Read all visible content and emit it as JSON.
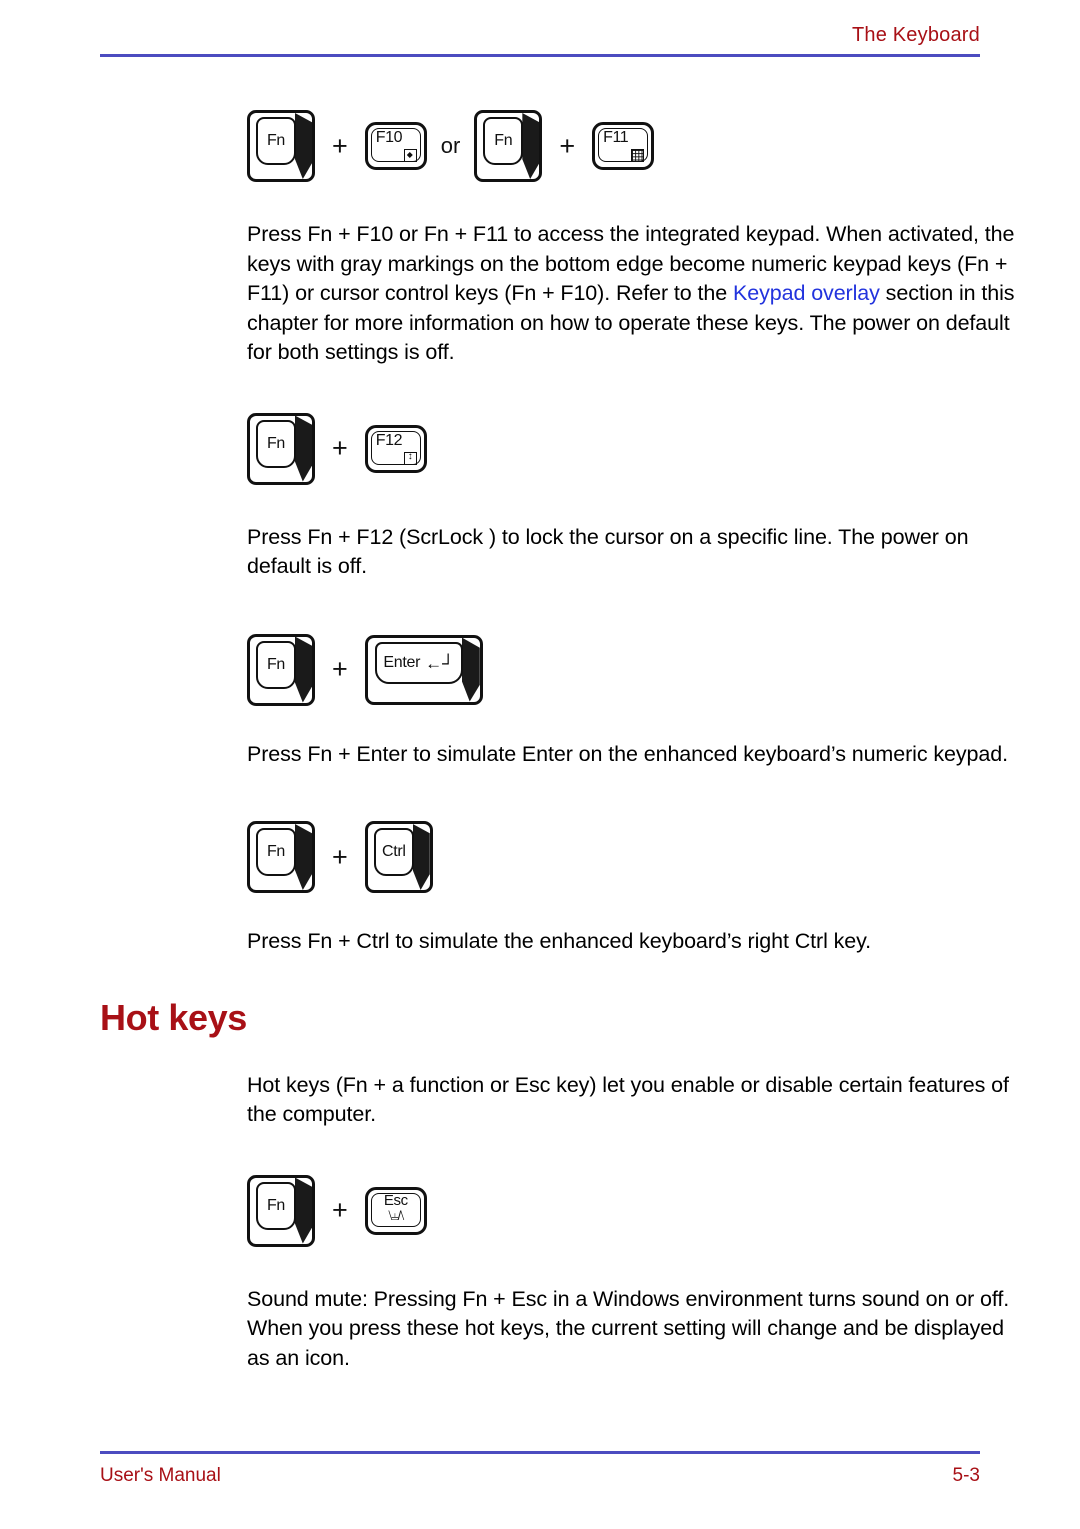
{
  "header": {
    "title": "The Keyboard",
    "rule_color": "#4c4cc0"
  },
  "footer": {
    "left": "User's Manual",
    "right": "5-3",
    "rule_color": "#4c4cc0",
    "text_color": "#a81016"
  },
  "keys": {
    "fn": "Fn",
    "f10": "F10",
    "f11": "F11",
    "f12": "F12",
    "enter": "Enter",
    "enter_arrow": "←┘",
    "ctrl": "Ctrl",
    "esc": "Esc",
    "esc_mute_glyph": "⧵⫨/⧵",
    "plus": "+",
    "or": "or"
  },
  "combos": {
    "keypad_overlay": {
      "first": "Fn",
      "second": "F10",
      "separator": "or",
      "third": "Fn",
      "fourth": "F11"
    },
    "scrlock": {
      "first": "Fn",
      "second": "F12"
    },
    "enter": {
      "first": "Fn",
      "second": "Enter"
    },
    "ctrl": {
      "first": "Fn",
      "second": "Ctrl"
    },
    "mute": {
      "first": "Fn",
      "second": "Esc"
    }
  },
  "paragraphs": {
    "keypad": {
      "before_link": "Press Fn + F10 or Fn + F11 to access the integrated keypad. When activated, the keys with gray markings on the bottom edge become numeric keypad keys (Fn + F11) or cursor control keys (Fn + F10). Refer to the ",
      "link": "Keypad overlay",
      "after_link": " section in this chapter for more information on how to operate these keys. The power on default for both settings is off."
    },
    "scrlock": "Press Fn + F12 (ScrLock ) to lock the cursor on a specific line. The power on default is off.",
    "enter": "Press Fn + Enter  to simulate Enter  on the enhanced keyboard’s numeric keypad.",
    "ctrl": "Press Fn + Ctrl  to simulate the enhanced keyboard’s right Ctrl  key.",
    "hotkeys_intro": "Hot keys (Fn + a function or Esc  key) let you enable or disable certain features of the computer.",
    "sound_mute": "Sound mute:  Pressing Fn + Esc  in a Windows environment turns sound on or off. When you press these hot keys, the current setting will change and be displayed as an icon."
  },
  "section": {
    "hot_keys_title": "Hot keys"
  },
  "colors": {
    "heading_red": "#a81016",
    "link_blue": "#2233dd",
    "rule_blue": "#4c4cc0"
  }
}
